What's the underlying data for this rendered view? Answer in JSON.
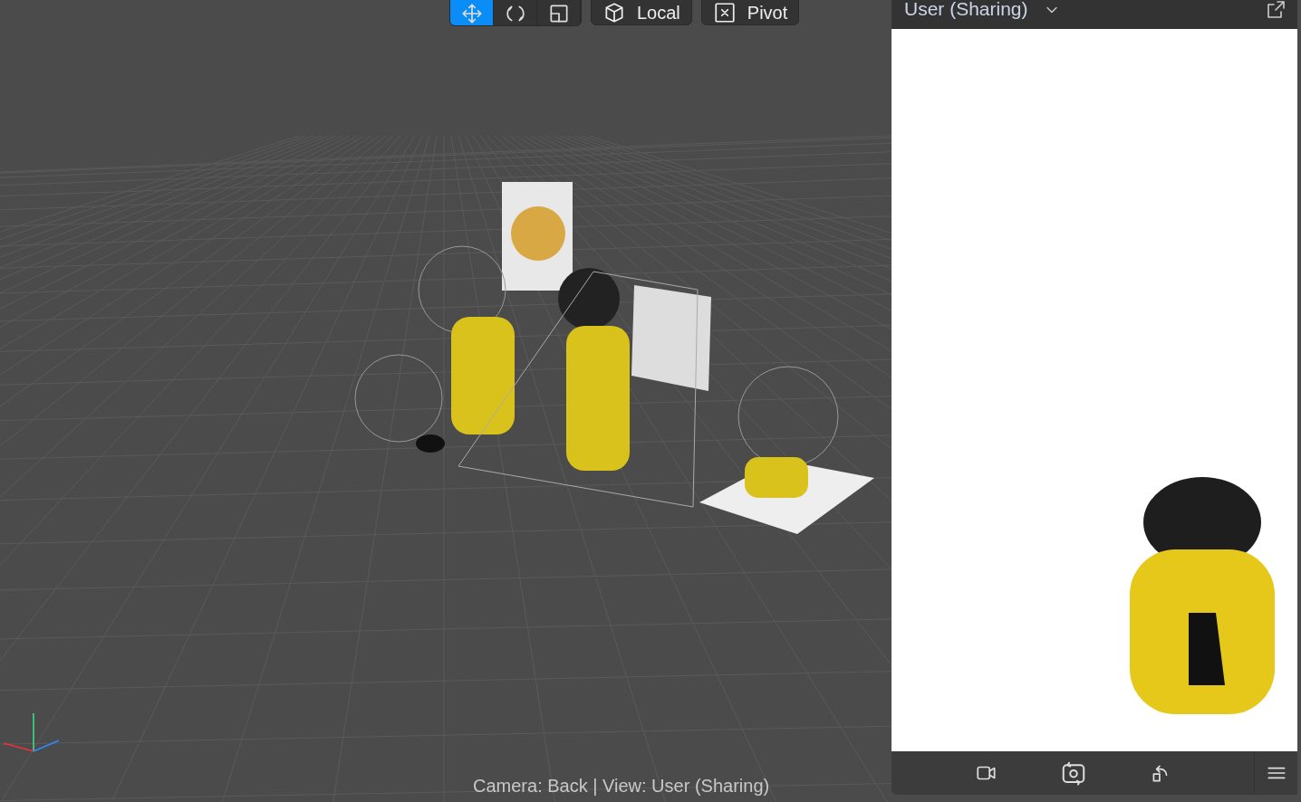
{
  "toolbar": {
    "transform_tools": [
      {
        "kind": "move",
        "selected": true
      },
      {
        "kind": "rotate",
        "selected": false
      },
      {
        "kind": "scale",
        "selected": false
      }
    ],
    "space_button": {
      "label": "Local"
    },
    "pivot_button": {
      "label": "Pivot"
    }
  },
  "viewport": {
    "status": "Camera: Back | View: User (Sharing)"
  },
  "preview": {
    "title": "User (Sharing)",
    "footer_tools": [
      {
        "kind": "camera"
      },
      {
        "kind": "switch-camera"
      },
      {
        "kind": "reset"
      }
    ]
  }
}
